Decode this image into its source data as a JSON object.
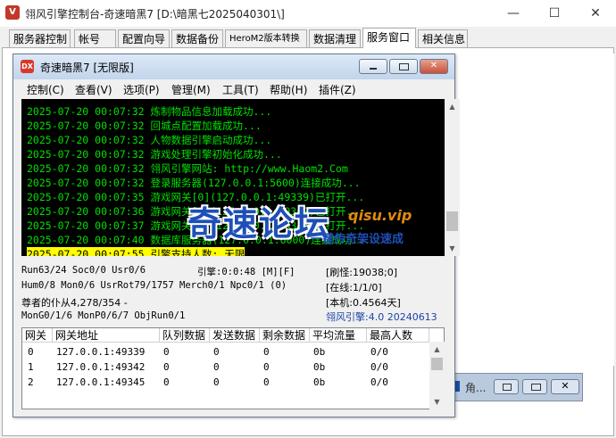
{
  "outer": {
    "app_icon": "V",
    "title": "翎风引擎控制台-奇速暗黑7 [D:\\暗黑七2025040301\\]",
    "minimize": "—",
    "maximize": "☐",
    "close": "✕",
    "tabs": [
      "服务器控制",
      "帐号",
      "配置向导",
      "数据备份",
      "HeroM2版本转换",
      "数据清理",
      "服务窗口",
      "相关信息"
    ]
  },
  "bg_window": {
    "title": "角..."
  },
  "inner": {
    "icon": "DX",
    "title": "奇速暗黑7 [无限版]",
    "menu": [
      "控制(C)",
      "查看(V)",
      "选项(P)",
      "管理(M)",
      "工具(T)",
      "帮助(H)",
      "插件(Z)"
    ]
  },
  "log": [
    "2025-07-20 00:07:32 炼制物品信息加载成功...",
    "2025-07-20 00:07:32 回城点配置加载成功...",
    "2025-07-20 00:07:32 人物数据引擎启动成功...",
    "2025-07-20 00:07:32 游戏处理引擎初始化成功...",
    "2025-07-20 00:07:32 翎风引擎网站: http://www.Haom2.Com",
    "2025-07-20 00:07:32 登录服务器(127.0.0.1:5600)连接成功...",
    "2025-07-20 00:07:35 游戏网关[0](127.0.0.1:49339)已打开...",
    "2025-07-20 00:07:36 游戏网关[1](127.0.0.1:49342)已打开...",
    "2025-07-20 00:07:37 游戏网关[2](127.0.0.1:49345)已打开...",
    "2025-07-20 00:07:40 数据库服务器(127.0.0.1:6000)连接成功...",
    "2025-07-20 00:07:55 引擎支持人数: 无限"
  ],
  "watermark": {
    "big": "奇速论坛",
    "url": "qisu.vip",
    "sub": "一键传奇架设速成"
  },
  "status": {
    "run": "Run63/24 Soc0/0 Usr0/6",
    "engine_time": "引擎:0:0:48 [M][F]",
    "refresh": "[刷怪:19038;0]",
    "hum": "Hum0/8 Mon0/6 UsrRot79/1757 Merch0/1 Npc0/1 (0)",
    "online": "[在线:1/1/0]",
    "honor": "尊者的仆从4,278/354 -",
    "local": "[本机:0.4564天]",
    "mong": "MonG0/1/6 MonP0/6/7 ObjRun0/1",
    "engine_version": "翎风引擎:4.0 20240613"
  },
  "table": {
    "headers": [
      "网关",
      "网关地址",
      "队列数据",
      "发送数据",
      "剩余数据",
      "平均流量",
      "最高人数"
    ],
    "rows": [
      [
        "0",
        "127.0.0.1:49339",
        "0",
        "0",
        "0",
        "0b",
        "0/0"
      ],
      [
        "1",
        "127.0.0.1:49342",
        "0",
        "0",
        "0",
        "0b",
        "0/0"
      ],
      [
        "2",
        "127.0.0.1:49345",
        "0",
        "0",
        "0",
        "0b",
        "0/0"
      ]
    ]
  }
}
